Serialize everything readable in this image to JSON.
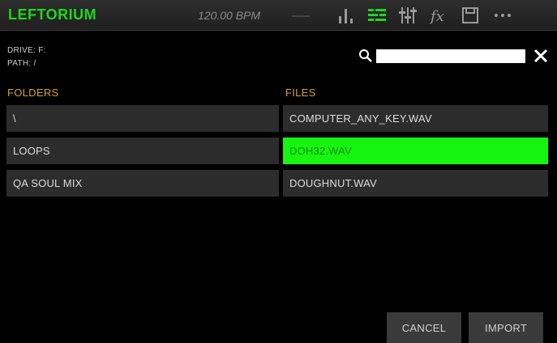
{
  "topbar": {
    "title": "LEFTORIUM",
    "bpm": "120.00 BPM",
    "icons": [
      "levels-icon",
      "browser-icon",
      "mixer-icon",
      "fx-icon",
      "save-icon",
      "more-icon"
    ]
  },
  "info": {
    "drive": "DRIVE: F:",
    "path": "PATH: /"
  },
  "search": {
    "value": "",
    "placeholder": ""
  },
  "folders": {
    "label": "FOLDERS",
    "items": [
      "\\",
      "LOOPS",
      "QA SOUL MIX"
    ]
  },
  "files": {
    "label": "FILES",
    "items": [
      "COMPUTER_ANY_KEY.WAV",
      "DOH32.WAV",
      "DOUGHNUT.WAV"
    ],
    "selected_index": 1
  },
  "buttons": {
    "cancel": "CANCEL",
    "import": "IMPORT"
  },
  "colors": {
    "accent_green": "#17f40f",
    "section_label": "#d4a127",
    "row_bg": "#2c2c2c"
  }
}
